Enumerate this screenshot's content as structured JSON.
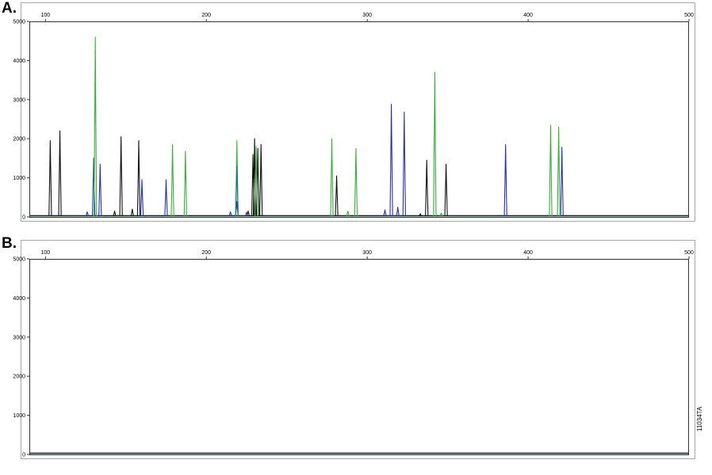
{
  "panels": [
    {
      "label": "A."
    },
    {
      "label": "B."
    }
  ],
  "figure_code": "11034TA",
  "colors": {
    "black": "#111111",
    "blue": "#2233a8",
    "green": "#38b038",
    "teal": "#127a7a",
    "frame": "#a8a8a8"
  },
  "chart_data": [
    {
      "panel": "A.",
      "type": "line",
      "xlim": [
        90,
        500
      ],
      "ylim": [
        0,
        5000
      ],
      "x_ticks": [
        100,
        200,
        300,
        400,
        500
      ],
      "y_ticks": [
        0,
        1000,
        2000,
        3000,
        4000,
        5000
      ],
      "grid": false,
      "series": [
        {
          "color": "black",
          "peaks": [
            {
              "x": 103,
              "y": 1950
            },
            {
              "x": 109,
              "y": 2200
            },
            {
              "x": 143,
              "y": 150
            },
            {
              "x": 147,
              "y": 2050
            },
            {
              "x": 154,
              "y": 200
            },
            {
              "x": 158,
              "y": 1950
            },
            {
              "x": 226,
              "y": 150
            },
            {
              "x": 229,
              "y": 1600
            },
            {
              "x": 230,
              "y": 2000
            },
            {
              "x": 232,
              "y": 1750
            },
            {
              "x": 234,
              "y": 1850
            },
            {
              "x": 281,
              "y": 1050
            },
            {
              "x": 333,
              "y": 80
            },
            {
              "x": 337,
              "y": 1450
            },
            {
              "x": 349,
              "y": 1350
            }
          ]
        },
        {
          "color": "blue",
          "peaks": [
            {
              "x": 126,
              "y": 130
            },
            {
              "x": 130,
              "y": 1500
            },
            {
              "x": 134,
              "y": 1350
            },
            {
              "x": 160,
              "y": 950
            },
            {
              "x": 175,
              "y": 950
            },
            {
              "x": 215,
              "y": 130
            },
            {
              "x": 219,
              "y": 400
            },
            {
              "x": 225,
              "y": 120
            },
            {
              "x": 311,
              "y": 180
            },
            {
              "x": 315,
              "y": 2880
            },
            {
              "x": 319,
              "y": 250
            },
            {
              "x": 323,
              "y": 2680
            },
            {
              "x": 386,
              "y": 1850
            },
            {
              "x": 421,
              "y": 1780
            }
          ]
        },
        {
          "color": "green",
          "peaks": [
            {
              "x": 131,
              "y": 4600
            },
            {
              "x": 179,
              "y": 1850
            },
            {
              "x": 187,
              "y": 1680
            },
            {
              "x": 219,
              "y": 1950
            },
            {
              "x": 231,
              "y": 1800
            },
            {
              "x": 278,
              "y": 2000
            },
            {
              "x": 288,
              "y": 150
            },
            {
              "x": 293,
              "y": 1750
            },
            {
              "x": 342,
              "y": 3700
            },
            {
              "x": 346,
              "y": 100
            },
            {
              "x": 414,
              "y": 2350
            },
            {
              "x": 419,
              "y": 2300
            }
          ]
        },
        {
          "color": "teal",
          "peaks": [
            {
              "x": 219,
              "y": 1300
            }
          ]
        }
      ]
    },
    {
      "panel": "B.",
      "type": "line",
      "xlim": [
        90,
        500
      ],
      "ylim": [
        0,
        5000
      ],
      "x_ticks": [
        100,
        200,
        300,
        400,
        500
      ],
      "y_ticks": [
        0,
        1000,
        2000,
        3000,
        4000,
        5000
      ],
      "grid": false,
      "series": [
        {
          "color": "black",
          "peaks": []
        },
        {
          "color": "blue",
          "peaks": []
        },
        {
          "color": "green",
          "peaks": []
        }
      ]
    }
  ]
}
